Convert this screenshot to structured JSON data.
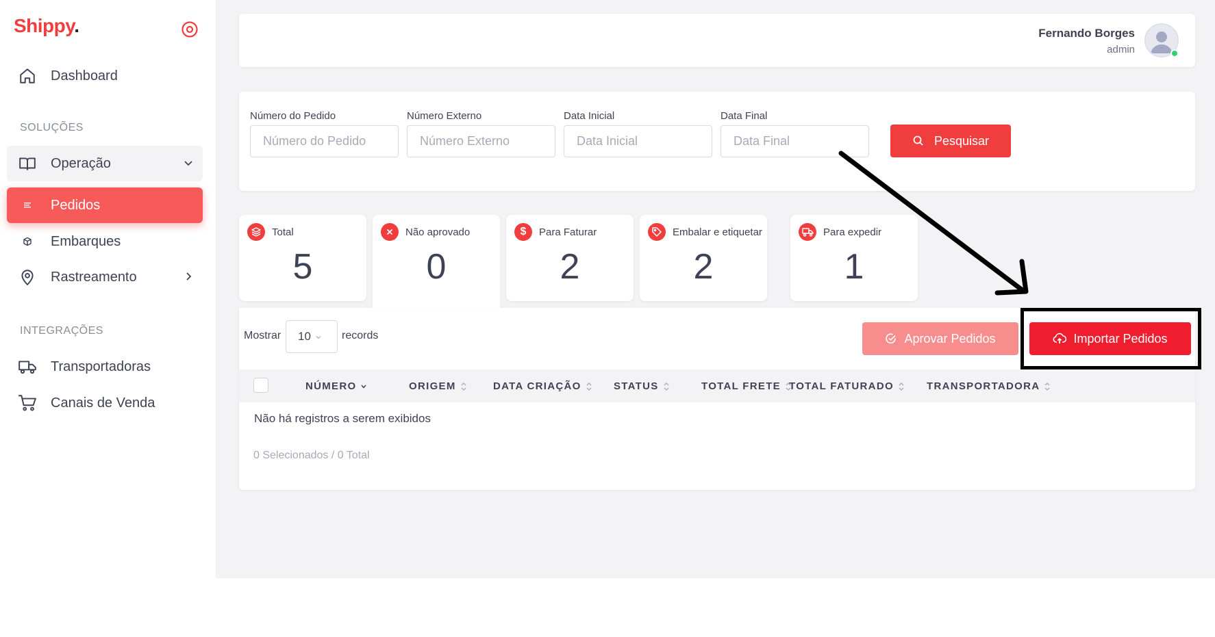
{
  "brand": {
    "name": "Shippy",
    "dot": "."
  },
  "sidebar": {
    "dashboard": "Dashboard",
    "section_solutions": "SOLUÇÕES",
    "operacao": "Operação",
    "pedidos": "Pedidos",
    "embarques": "Embarques",
    "rastreamento": "Rastreamento",
    "section_integrations": "INTEGRAÇÕES",
    "transportadoras": "Transportadoras",
    "canais": "Canais de Venda"
  },
  "user": {
    "name": "Fernando Borges",
    "role": "admin"
  },
  "filters": {
    "numero_pedido": {
      "label": "Número do Pedido",
      "placeholder": "Número do Pedido",
      "value": ""
    },
    "numero_externo": {
      "label": "Número Externo",
      "placeholder": "Número Externo",
      "value": ""
    },
    "data_inicial": {
      "label": "Data Inicial",
      "placeholder": "Data Inicial",
      "value": ""
    },
    "data_final": {
      "label": "Data Final",
      "placeholder": "Data Final",
      "value": ""
    },
    "search_label": "Pesquisar"
  },
  "stats": [
    {
      "label": "Total",
      "value": "5",
      "icon": "layers-icon"
    },
    {
      "label": "Não aprovado",
      "value": "0",
      "icon": "x-circle-icon"
    },
    {
      "label": "Para Faturar",
      "value": "2",
      "icon": "dollar-icon"
    },
    {
      "label": "Embalar e etiquetar",
      "value": "2",
      "icon": "tag-icon"
    },
    {
      "label": "Para expedir",
      "value": "1",
      "icon": "truck-icon"
    }
  ],
  "table": {
    "show_label": "Mostrar",
    "page_size": "10",
    "records_label": "records",
    "approve_label": "Aprovar Pedidos",
    "import_label": "Importar Pedidos",
    "columns": [
      "NÚMERO",
      "ORIGEM",
      "DATA CRIAÇÃO",
      "STATUS",
      "TOTAL FRETE",
      "TOTAL FATURADO",
      "TRANSPORTADORA"
    ],
    "empty_message": "Não há registros a serem exibidos",
    "footer": "0 Selecionados / 0 Total"
  },
  "colors": {
    "accent": "#f03e3e",
    "active_nav": "#f85a5a",
    "approve_button": "#f88d8d",
    "import_button": "#f01d2e"
  }
}
